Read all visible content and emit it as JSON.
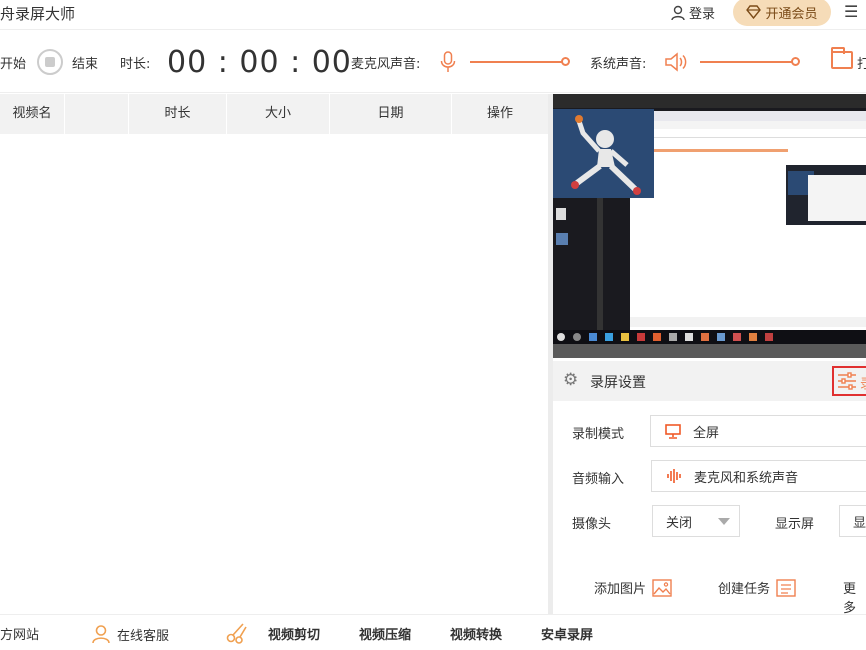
{
  "titlebar": {
    "title": "舟录屏大师",
    "login_label": "登录",
    "vip_label": "开通会员"
  },
  "toolbar": {
    "start_label": "开始",
    "stop_label": "结束",
    "duration_label": "时长:",
    "timer": "00 : 00 : 00",
    "mic_label": "麦克风声音:",
    "system_label": "系统声音:",
    "open_label": "打"
  },
  "table": {
    "columns": [
      "视频名",
      "时长",
      "大小",
      "日期",
      "操作"
    ]
  },
  "settings": {
    "title": "录屏设置",
    "advanced_label": "录",
    "mode_label": "录制模式",
    "mode_value": "全屏",
    "audio_label": "音频输入",
    "audio_value": "麦克风和系统声音",
    "camera_label": "摄像头",
    "camera_value": "关闭",
    "display_label": "显示屏",
    "display_value": "显",
    "add_image_label": "添加图片",
    "create_task_label": "创建任务",
    "more_label": "更多"
  },
  "bottombar": {
    "website_label": "方网站",
    "service_label": "在线客服",
    "clip_label": "视频剪切",
    "compress_label": "视频压缩",
    "convert_label": "视频转换",
    "android_label": "安卓录屏"
  },
  "colors": {
    "accent": "#f08050",
    "vip_bg": "#f6dcb8",
    "highlight_border": "#e03030"
  }
}
